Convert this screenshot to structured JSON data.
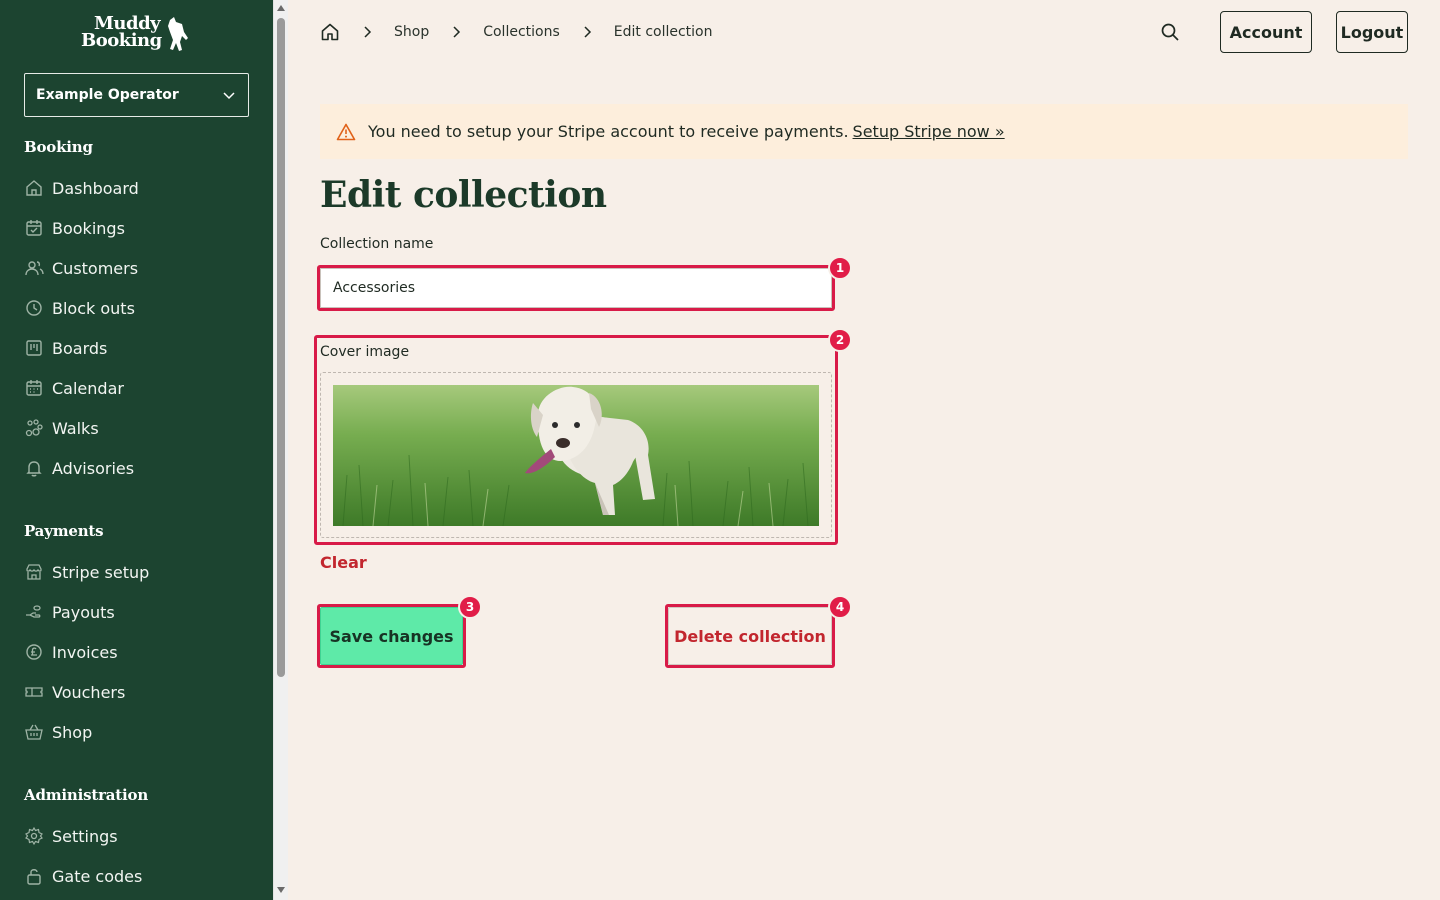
{
  "brand": {
    "line1": "Muddy",
    "line2": "Booking"
  },
  "operator": {
    "selected": "Example Operator"
  },
  "sidebar": {
    "booking_title": "Booking",
    "booking_items": [
      {
        "label": "Dashboard",
        "icon": "home-icon"
      },
      {
        "label": "Bookings",
        "icon": "calendar-check-icon"
      },
      {
        "label": "Customers",
        "icon": "users-icon"
      },
      {
        "label": "Block outs",
        "icon": "clock-icon"
      },
      {
        "label": "Boards",
        "icon": "board-icon"
      },
      {
        "label": "Calendar",
        "icon": "calendar-icon"
      },
      {
        "label": "Walks",
        "icon": "paw-icon"
      },
      {
        "label": "Advisories",
        "icon": "bell-icon"
      }
    ],
    "payments_title": "Payments",
    "payments_items": [
      {
        "label": "Stripe setup",
        "icon": "store-icon"
      },
      {
        "label": "Payouts",
        "icon": "payout-icon"
      },
      {
        "label": "Invoices",
        "icon": "pound-icon"
      },
      {
        "label": "Vouchers",
        "icon": "ticket-icon"
      },
      {
        "label": "Shop",
        "icon": "basket-icon"
      }
    ],
    "admin_title": "Administration",
    "admin_items": [
      {
        "label": "Settings",
        "icon": "gear-icon"
      },
      {
        "label": "Gate codes",
        "icon": "lock-icon"
      }
    ]
  },
  "breadcrumb": {
    "items": [
      "Shop",
      "Collections",
      "Edit collection"
    ]
  },
  "header": {
    "account_label": "Account",
    "logout_label": "Logout"
  },
  "alert": {
    "message": "You need to setup your Stripe account to receive payments.",
    "link": "Setup Stripe now »"
  },
  "page": {
    "title": "Edit collection"
  },
  "form": {
    "name_label": "Collection name",
    "name_value": "Accessories",
    "cover_label": "Cover image",
    "clear_label": "Clear",
    "save_label": "Save changes",
    "delete_label": "Delete collection"
  },
  "annotations": [
    "1",
    "2",
    "3",
    "4"
  ],
  "colors": {
    "sidebar_bg": "#1c4430",
    "page_bg": "#f7efe8",
    "accent_green": "#5eeaa8",
    "danger": "#c2262e",
    "highlight": "#d81b48",
    "alert_bg": "#fdeedc"
  }
}
